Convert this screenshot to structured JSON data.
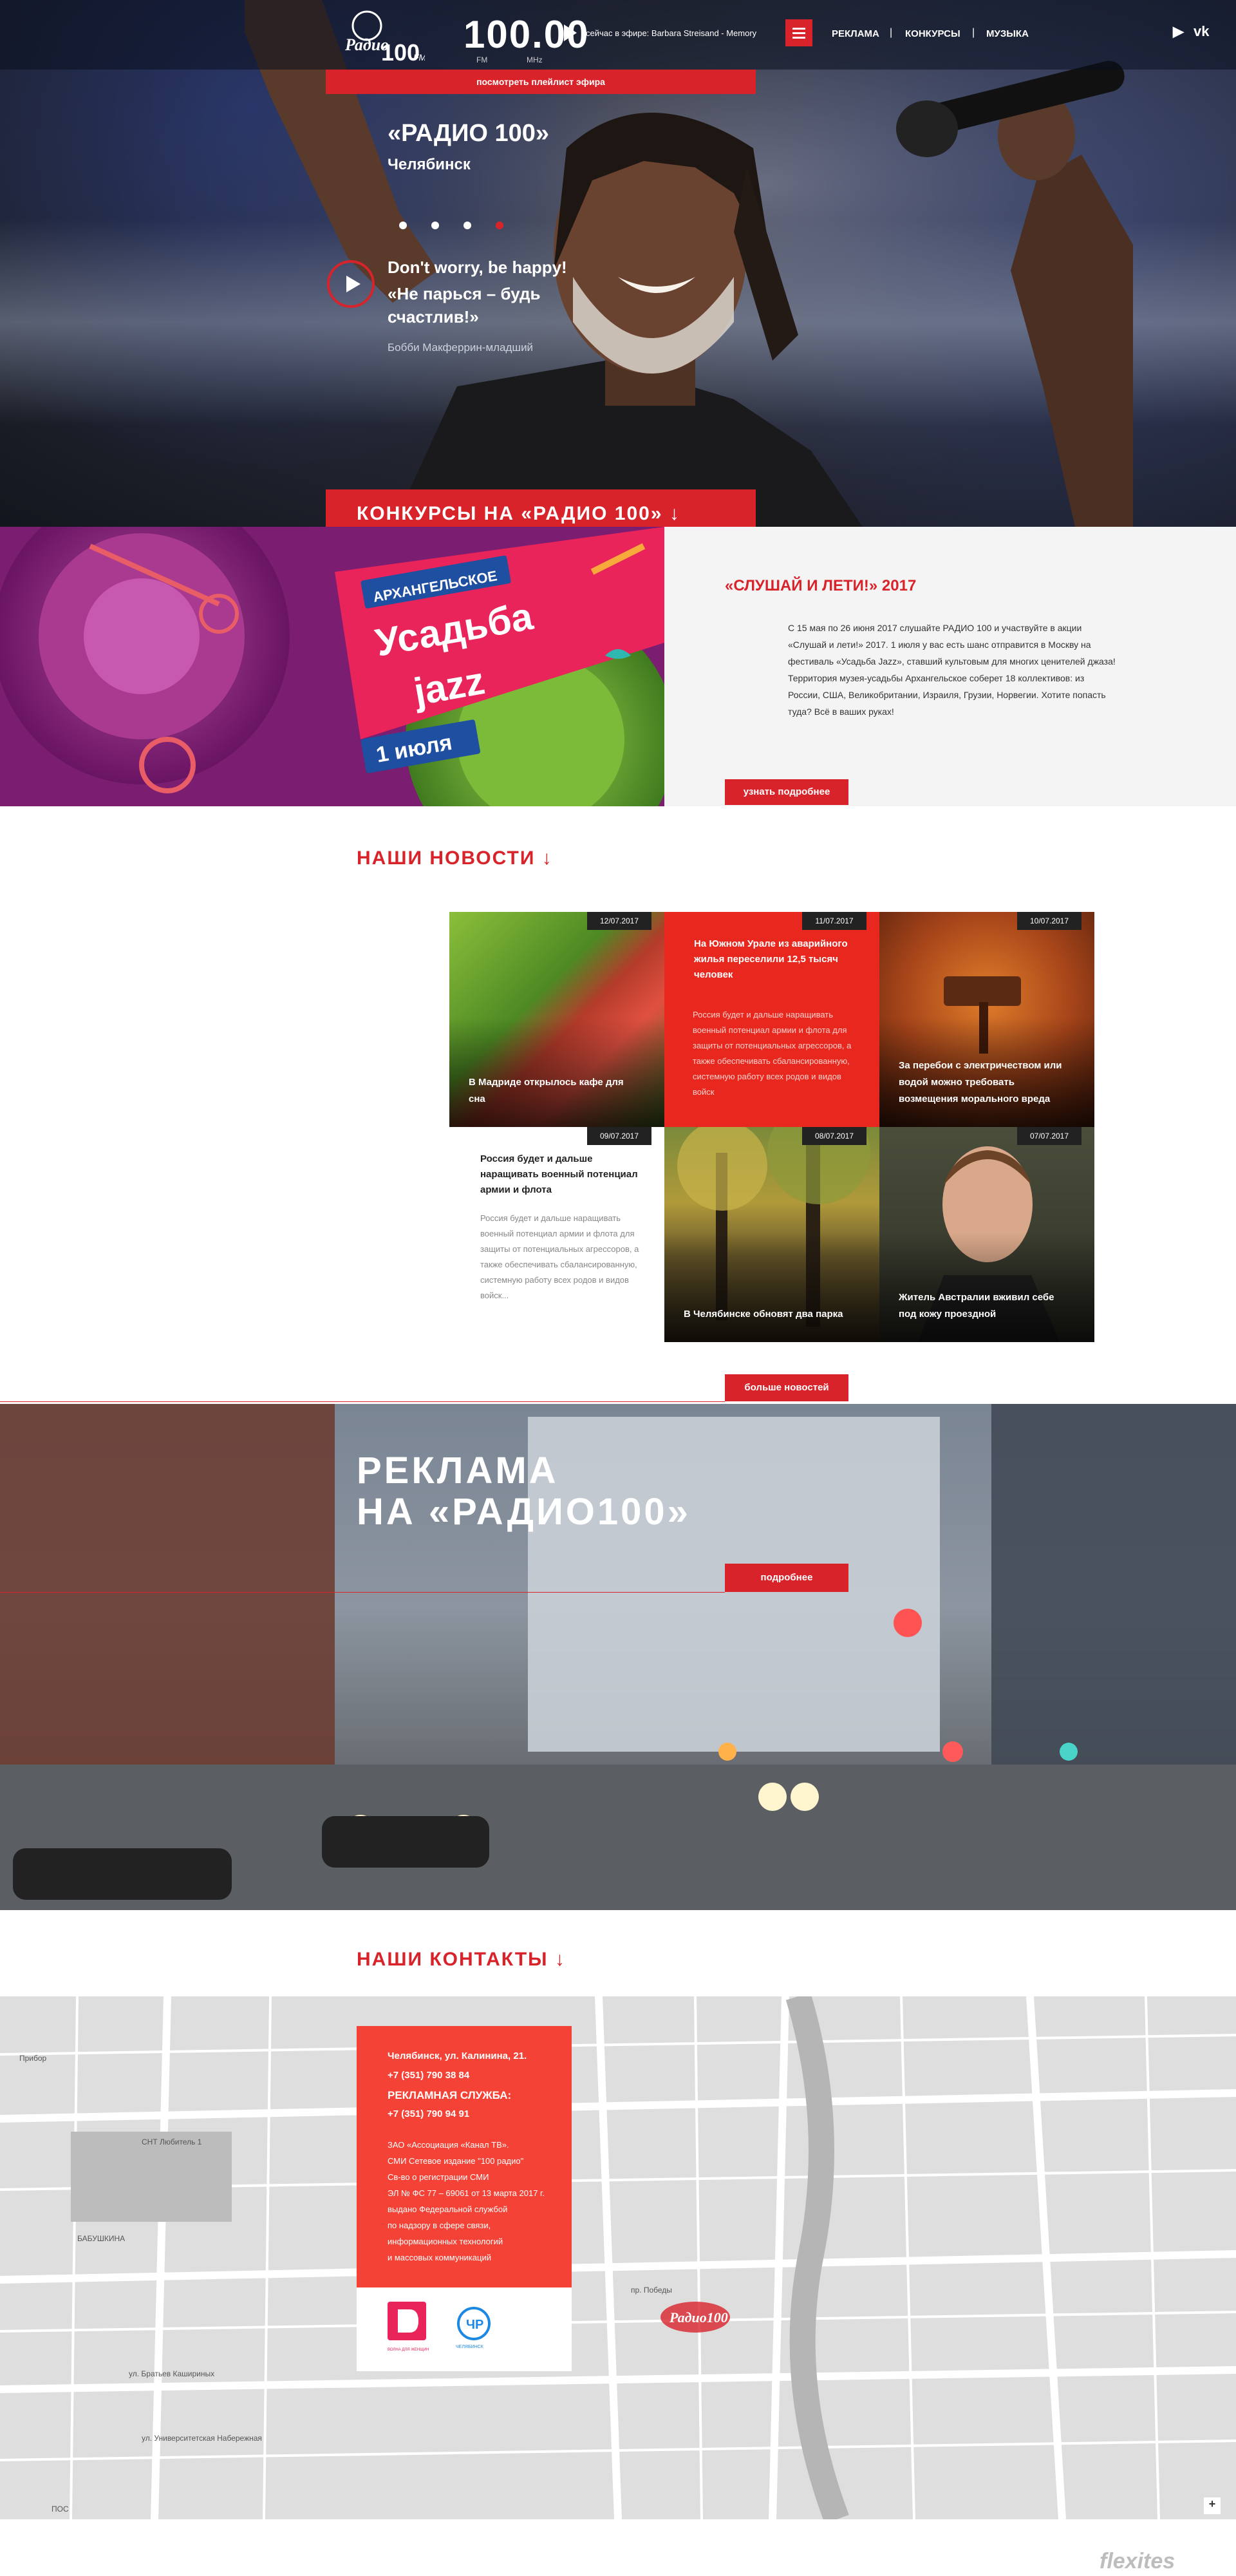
{
  "header": {
    "freq": "100.00",
    "freq_fm": "FM",
    "freq_mhz": "MHz",
    "now_playing": "сейчас в эфире: Barbara Streisand - Memory",
    "playlist_btn": "посмотреть плейлист эфира",
    "nav": [
      "РЕКЛАМА",
      "КОНКУРСЫ",
      "МУЗЫКА"
    ],
    "nav_sep": "|",
    "social": [
      "▶",
      "vk"
    ]
  },
  "hero": {
    "title": "«РАДИО 100»",
    "city": "Челябинск",
    "quote_en": "Don't worry, be happy!",
    "quote_ru": "«Не парься – будь счастлив!»",
    "author": "Бобби Макферрин-младший",
    "slides": 4,
    "active_slide": 4
  },
  "contest": {
    "head": "КОНКУРСЫ НА «РАДИО 100» ↓",
    "poster": {
      "line1": "АРХАНГЕЛЬСКОЕ",
      "line2": "Усадьба",
      "line3": "jazz",
      "line4": "1 июля"
    },
    "title": "«СЛУШАЙ И ЛЕТИ!»  2017",
    "text": "С 15 мая по 26 июня 2017 слушайте РАДИО 100 и участвуйте в акции «Слушай и лети!» 2017. 1 июля у вас есть шанс отправится в Москву на фестиваль «Усадьба Jazz», ставший культовым для многих ценителей джаза! Территория музея-усадьбы Архангельское соберет 18 коллективов: из России, США, Великобритании, Израиля, Грузии, Норвегии.  Хотите попасть туда? Всё в ваших руках!",
    "btn": "узнать подробнее"
  },
  "news": {
    "head": "НАШИ НОВОСТИ  ↓",
    "items": [
      {
        "date": "12/07.2017",
        "title": "В Мадриде открылось кафе для сна"
      },
      {
        "date": "11/07.2017",
        "title": "На Южном Урале из аварийного жилья переселили 12,5 тысяч человек",
        "text": "Россия будет и дальше наращивать военный потенциал армии и флота для защиты от потенциальных агрессоров, а также обеспечивать сбалансированную, системную работу всех родов и видов войск"
      },
      {
        "date": "10/07.2017",
        "title": "За перебои с электричеством или водой можно требовать возмещения морального вреда"
      },
      {
        "date": "09/07.2017",
        "title": "Россия будет и дальше наращивать военный потенциал армии и флота",
        "text": "Россия будет и дальше наращивать военный потенциал армии и флота для защиты от потенциальных агрессоров, а также обеспечивать сбалансированную, системную работу всех родов и видов войск..."
      },
      {
        "date": "08/07.2017",
        "title": "В Челябинске обновят два парка"
      },
      {
        "date": "07/07.2017",
        "title": "Житель Австралии вживил себе под кожу проездной"
      }
    ],
    "more_btn": "больше новостей"
  },
  "ads": {
    "title_line1": "РЕКЛАМА",
    "title_line2": "НА «РАДИО100»",
    "btn": "подробнее"
  },
  "contacts": {
    "head": "НАШИ КОНТАКТЫ  ↓",
    "address": "Челябинск, ул. Калинина, 21.",
    "phone1": "+7 (351) 790 38 84",
    "ad_service": "РЕКЛАМНАЯ СЛУЖБА:",
    "phone2": "+7 (351) 790 94 91",
    "legal": "ЗАО «Ассоциация «Канал ТВ».\nСМИ Сетевое издание \"100 радио\"\nСв-во о регистрации СМИ\nЭЛ № ФС 77 – 69061 от 13 марта 2017 г.\nвыдано Федеральной службой\nпо надзору в сфере связи,\nинформационных технологий\nи массовых коммуникаций",
    "logo1_caption": "ВОЛНА ДЛЯ ЖЕНЩИН",
    "logo2_caption": "ЧЕЛЯБИНСК",
    "map_labels": [
      "Прибор",
      "пр. Победы",
      "БАБУШКИНА",
      "СНТ Любитель 1",
      "ул. Братьев Кашириных",
      "ул. Университетская Набережная",
      "ПОС"
    ],
    "zoom": "+"
  },
  "footer": {
    "watermark": "flexites"
  },
  "colors": {
    "accent": "#d8232a",
    "card": "#f44336",
    "map": "#dedede"
  }
}
